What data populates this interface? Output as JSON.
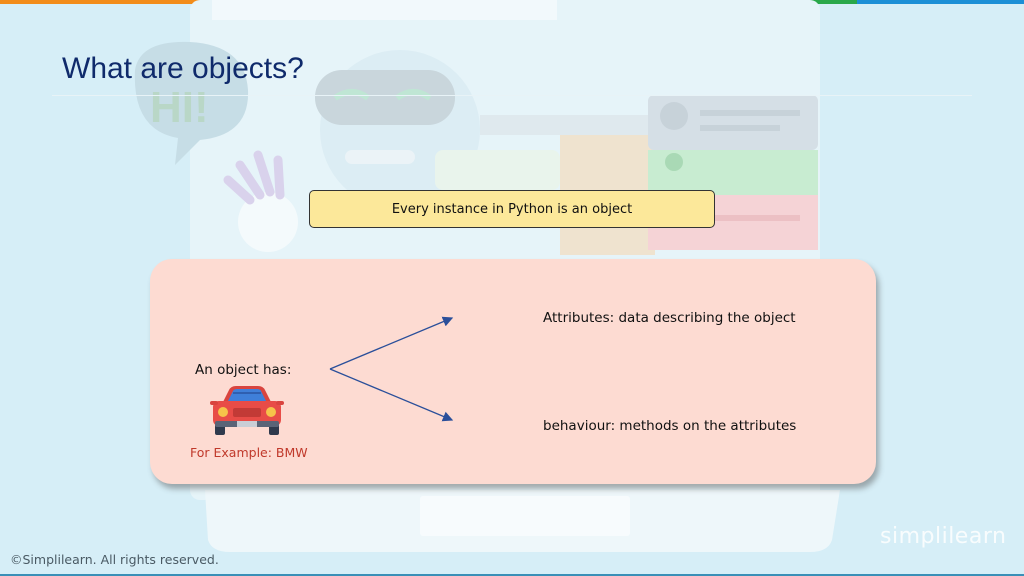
{
  "slide": {
    "title": "What are objects?",
    "banner_text": "Every instance in Python is an object",
    "object_label": "An object has:",
    "attributes_text": "Attributes: data describing the object",
    "behaviour_text": "behaviour: methods on the attributes",
    "example_text": "For Example: BMW",
    "car_icon": "car-icon",
    "arrow_icon": "arrow-icon"
  },
  "footer": {
    "copyright": "©Simplilearn. All rights reserved.",
    "logo_text": "simplilearn"
  },
  "colors": {
    "title": "#0f2a6b",
    "banner_fill": "#fce89a",
    "panel_fill": "#fddbd2",
    "arrow": "#2a4f9a",
    "example_text": "#c0392b",
    "background": "#d6eef7"
  },
  "top_bar_colors": [
    "#f28c1a",
    "#e84c1c",
    "#2aa84a",
    "#1c8fd6"
  ]
}
